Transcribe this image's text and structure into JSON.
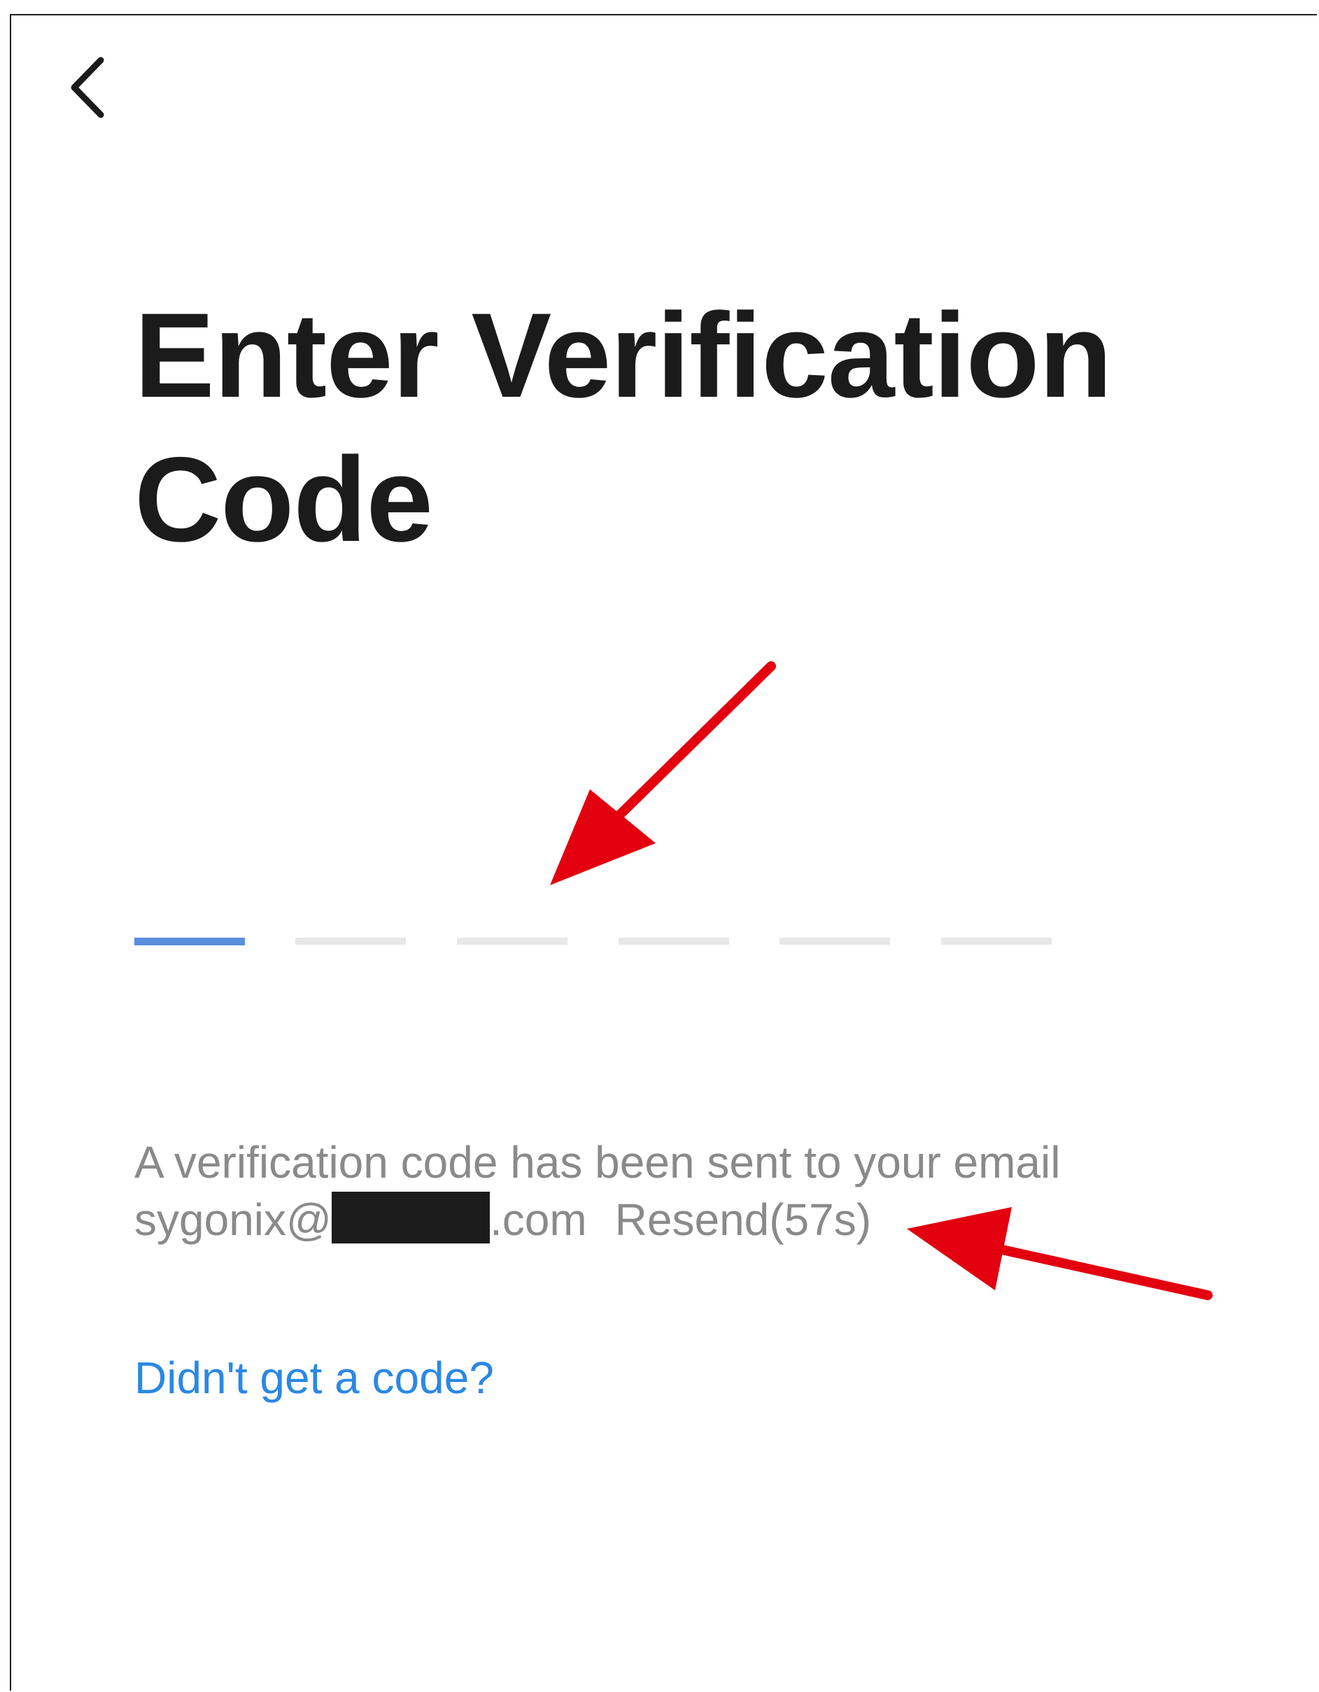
{
  "header": {
    "back_icon": "chevron-left-icon"
  },
  "page": {
    "title_line1": "Enter Verification",
    "title_line2": "Code"
  },
  "code_input": {
    "length": 6,
    "active_index": 0,
    "active_color": "#5a8fde",
    "inactive_color": "#e8e8e8"
  },
  "info": {
    "message": "A verification code has been sent to your email",
    "email_prefix": "sygonix@",
    "email_suffix": ".com",
    "resend_label": "Resend(57s)"
  },
  "help": {
    "link_label": "Didn't get a code?"
  },
  "annotations": {
    "arrow_color": "#e3000f"
  }
}
